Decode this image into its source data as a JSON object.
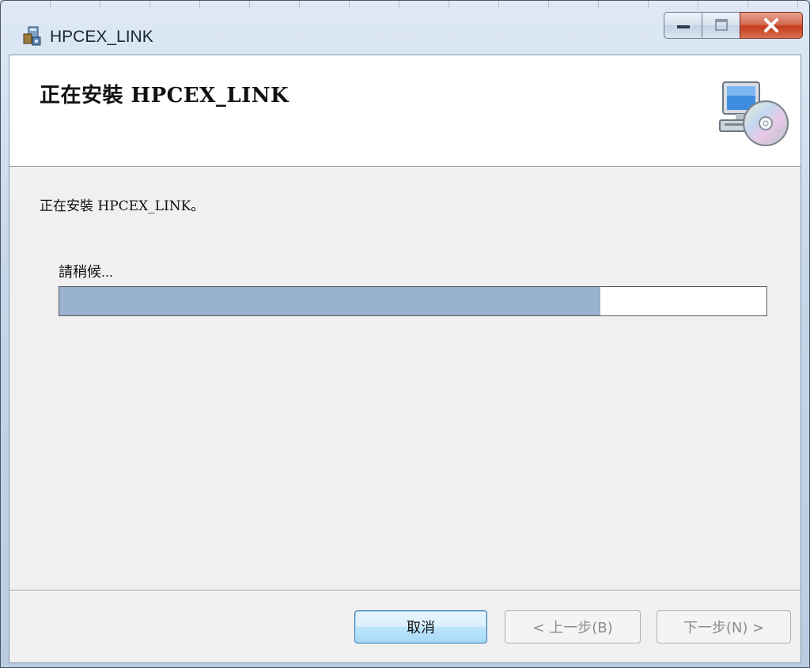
{
  "window": {
    "title": "HPCEX_LINK"
  },
  "banner": {
    "title": "正在安裝 HPCEX_LINK",
    "icon": "computer-cd-icon"
  },
  "main": {
    "status_text": "正在安裝 HPCEX_LINK。",
    "wait_text": "請稍候...",
    "progress": 0.765
  },
  "footer": {
    "cancel_label": "取消",
    "back_label": "< 上一步(B)",
    "next_label": "下一步(N) >"
  },
  "colors": {
    "progress_fill": "#98b2cf",
    "close_button": "#c43b1e"
  }
}
